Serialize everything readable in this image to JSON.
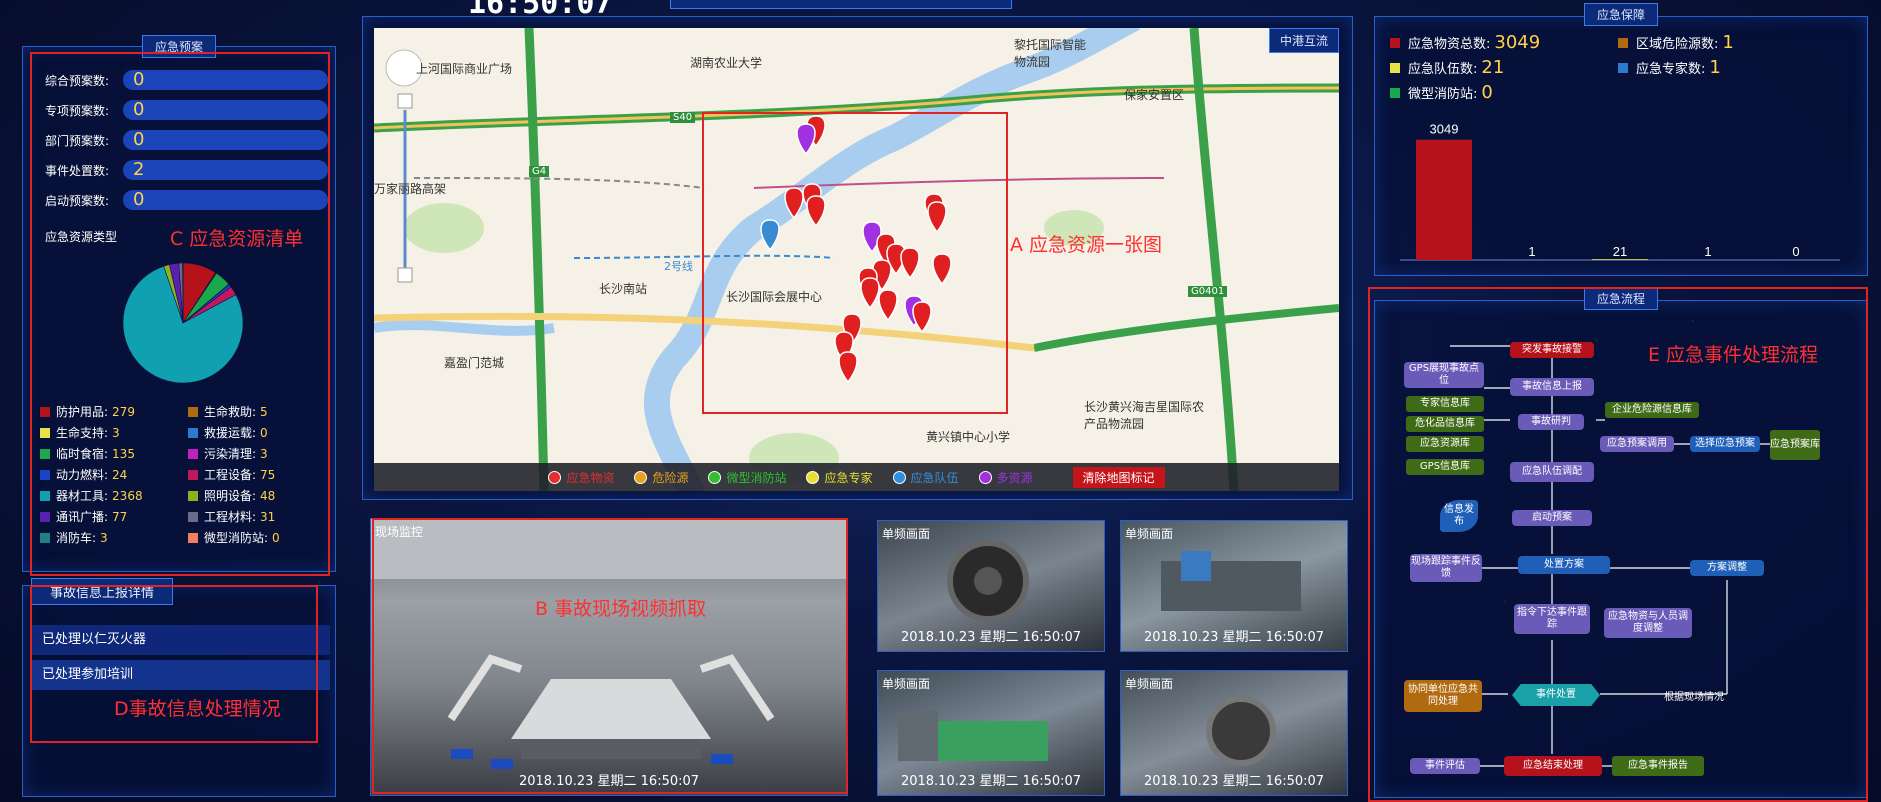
{
  "header": {
    "clock": "16:50:07"
  },
  "left": {
    "title": "应急预案",
    "plans": [
      {
        "label": "综合预案数:",
        "value": "0"
      },
      {
        "label": "专项预案数:",
        "value": "0"
      },
      {
        "label": "部门预案数:",
        "value": "0"
      },
      {
        "label": "事件处置数:",
        "value": "2"
      },
      {
        "label": "启动预案数:",
        "value": "0"
      }
    ],
    "resource_type_label": "应急资源类型",
    "legend": [
      {
        "label": "防护用品:",
        "value": "279",
        "color": "#b5121b"
      },
      {
        "label": "生命救助:",
        "value": "5",
        "color": "#b06a10"
      },
      {
        "label": "生命支持:",
        "value": "3",
        "color": "#e8e24a"
      },
      {
        "label": "救援运载:",
        "value": "0",
        "color": "#2b7bd0"
      },
      {
        "label": "临时食宿:",
        "value": "135",
        "color": "#1aa84a"
      },
      {
        "label": "污染清理:",
        "value": "3",
        "color": "#c020c0"
      },
      {
        "label": "动力燃料:",
        "value": "24",
        "color": "#1845c8"
      },
      {
        "label": "工程设备:",
        "value": "75",
        "color": "#c01860"
      },
      {
        "label": "器材工具:",
        "value": "2368",
        "color": "#10a0b0"
      },
      {
        "label": "照明设备:",
        "value": "48",
        "color": "#8fb020"
      },
      {
        "label": "通讯广播:",
        "value": "77",
        "color": "#5a20b0"
      },
      {
        "label": "工程材料:",
        "value": "31",
        "color": "#6a6a8a"
      },
      {
        "label": "消防车:",
        "value": "3",
        "color": "#208080"
      },
      {
        "label": "微型消防站:",
        "value": "0",
        "color": "#f08060"
      }
    ],
    "report_title": "事故信息上报详情",
    "reports": [
      "已处理以仁灭火器",
      "已处理参加培训"
    ]
  },
  "annotations": {
    "a": "A 应急资源一张图",
    "b": "B 事故现场视频抓取",
    "c": "C 应急资源清单",
    "d": "D事故信息处理情况",
    "e": "E 应急事件处理流程"
  },
  "map": {
    "tab": "中港互流",
    "labels": {
      "university": "湖南农业大学",
      "plaza": "上河国际商业广场",
      "logistics": "黎托国际智能物流园",
      "baojia": "保家安置区",
      "changsha_south": "长沙南站",
      "expo": "长沙国际会展中心",
      "wanjia": "万家丽路高架",
      "huangxing": "黄兴镇中心小学",
      "agri": "长沙黄兴海吉星国际农产品物流园",
      "jiayinmen": "嘉盈门范城",
      "s40": "S40",
      "g4": "G4",
      "g0401": "G0401",
      "line2": "2号线",
      "line2b": "2号线"
    },
    "legend": [
      {
        "label": "应急物资",
        "color": "#e23030"
      },
      {
        "label": "危险源",
        "color": "#e8a020"
      },
      {
        "label": "微型消防站",
        "color": "#30c030"
      },
      {
        "label": "应急专家",
        "color": "#e8e030"
      },
      {
        "label": "应急队伍",
        "color": "#3090e0"
      },
      {
        "label": "多资源",
        "color": "#a030e0"
      }
    ],
    "clear_label": "清除地图标记"
  },
  "videos": {
    "main": {
      "title": "现场监控",
      "ts": "2018.10.23   星期二   16:50:07"
    },
    "small": [
      {
        "title": "单频画面",
        "ts": "2018.10.23   星期二   16:50:07"
      },
      {
        "title": "单频画面",
        "ts": "2018.10.23   星期二   16:50:07"
      },
      {
        "title": "单频画面",
        "ts": "2018.10.23   星期二   16:50:07"
      },
      {
        "title": "单频画面",
        "ts": "2018.10.23   星期二   16:50:07"
      }
    ]
  },
  "right": {
    "title": "应急保障",
    "stats": [
      {
        "label": "应急物资总数:",
        "value": "3049",
        "color": "#b5121b"
      },
      {
        "label": "区域危险源数:",
        "value": "1",
        "color": "#b06a10"
      },
      {
        "label": "应急队伍数:",
        "value": "21",
        "color": "#e8e24a"
      },
      {
        "label": "应急专家数:",
        "value": "1",
        "color": "#2b7bd0"
      },
      {
        "label": "微型消防站:",
        "value": "0",
        "color": "#1aa84a"
      }
    ],
    "chart_data": {
      "type": "bar",
      "categories": [
        "应急物资总数",
        "区域危险源数",
        "应急队伍数",
        "应急专家数",
        "微型消防站"
      ],
      "values": [
        3049,
        1,
        21,
        1,
        0
      ],
      "value_labels": [
        "3049",
        "1",
        "21",
        "1",
        "0"
      ],
      "colors": [
        "#b5121b",
        "#b06a10",
        "#e8e24a",
        "#2b7bd0",
        "#1aa84a"
      ],
      "ylim": [
        0,
        3600
      ]
    }
  },
  "flow": {
    "title": "应急流程",
    "nodes": {
      "receive": "突发事故接警",
      "gps_show": "GPS展现事故点位",
      "report": "事故信息上报",
      "expert_db": "专家信息库",
      "hazard_db": "危化品信息库",
      "resource_db": "应急资源库",
      "gps_db": "GPS信息库",
      "judge": "事故研判",
      "enterprise_db": "企业危险源信息库",
      "plan_call": "应急预案调用",
      "choose_plan": "选择应急预案",
      "plan_lib": "应急预案库",
      "team": "应急队伍调配",
      "publish": "信息发布",
      "start_plan": "启动预案",
      "track": "现场跟踪事件反馈",
      "handle_plan": "处置方案",
      "adjust": "方案调整",
      "order": "指令下达事件跟踪",
      "dispatch": "应急物资与人员调度调整",
      "cooperate": "协同单位应急共同处理",
      "dispose": "事件处置",
      "by_situation": "根据现场情况",
      "evaluate": "事件评估",
      "end": "应急结束处理",
      "final_report": "应急事件报告"
    }
  }
}
